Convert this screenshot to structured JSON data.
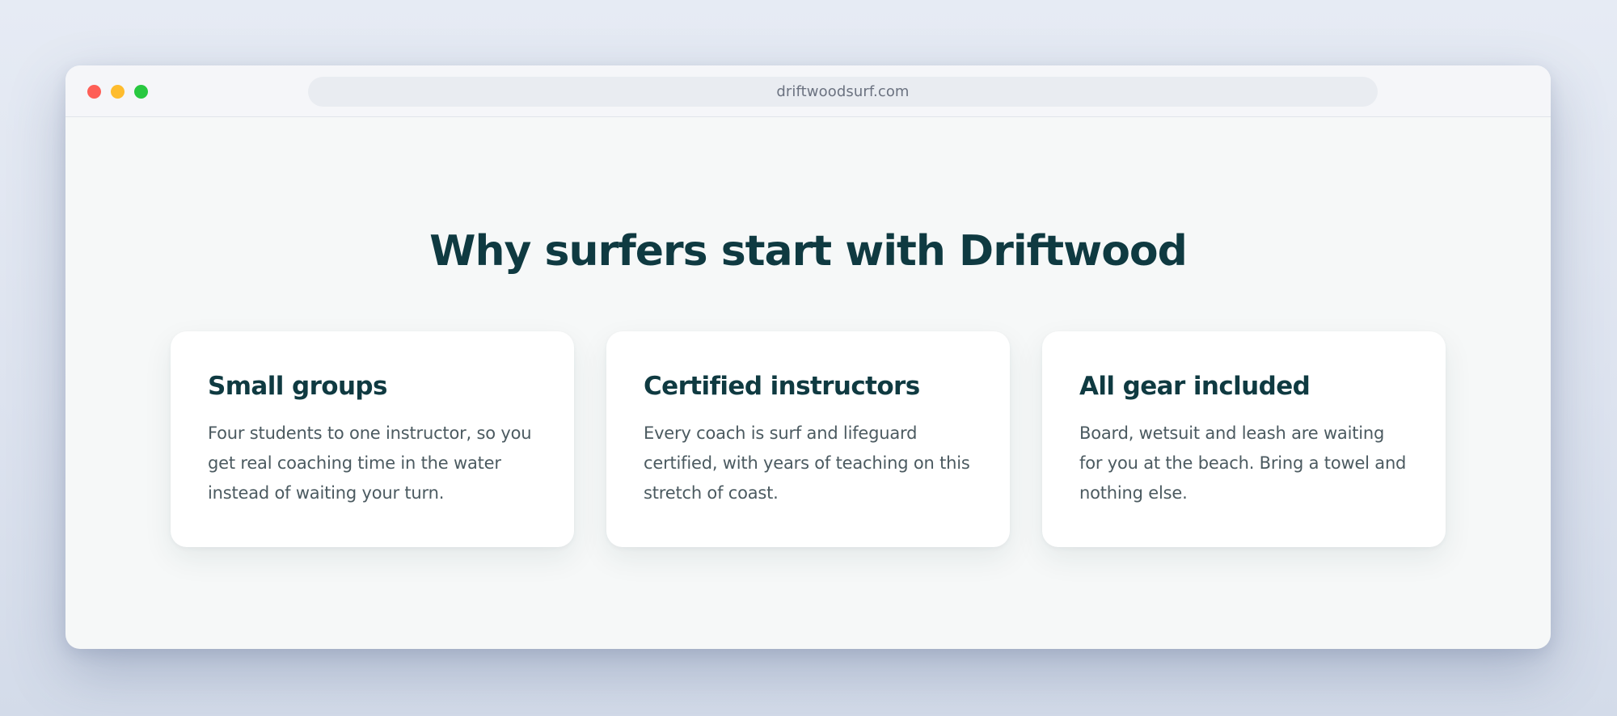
{
  "browser": {
    "url": "driftwoodsurf.com"
  },
  "page": {
    "headline": "Why surfers start with Driftwood",
    "features": [
      {
        "title": "Small groups",
        "body": "Four students to one instructor, so you get real coaching time in the water instead of waiting your turn."
      },
      {
        "title": "Certified instructors",
        "body": "Every coach is surf and lifeguard certified, with years of teaching on this stretch of coast."
      },
      {
        "title": "All gear included",
        "body": "Board, wetsuit and leash are waiting for you at the beach. Bring a towel and nothing else."
      }
    ]
  },
  "colors": {
    "heading": "#0f3a41",
    "body_text": "#4b5a60",
    "close": "#fe5f57",
    "minimize": "#febc2e",
    "maximize": "#28c840"
  }
}
